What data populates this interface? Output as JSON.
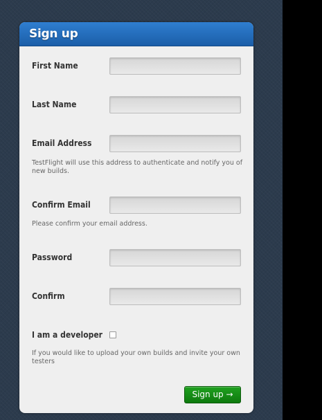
{
  "form": {
    "title": "Sign up",
    "fields": [
      {
        "label": "First Name",
        "value": "",
        "help": ""
      },
      {
        "label": "Last Name",
        "value": "",
        "help": ""
      },
      {
        "label": "Email Address",
        "value": "",
        "help": "TestFlight will use this address to authenticate and notify you of new builds."
      },
      {
        "label": "Confirm Email",
        "value": "",
        "help": "Please confirm your email address."
      },
      {
        "label": "Password",
        "value": "",
        "help": ""
      },
      {
        "label": "Confirm",
        "value": "",
        "help": ""
      }
    ],
    "developer": {
      "label": "I am a developer",
      "checked": false,
      "help": "If you would like to upload your own builds and invite your own testers"
    },
    "submit_label": "Sign up →"
  },
  "colors": {
    "page_background": "#2c3b4d",
    "header_blue": "#1f68b8",
    "submit_green": "#138b13"
  }
}
